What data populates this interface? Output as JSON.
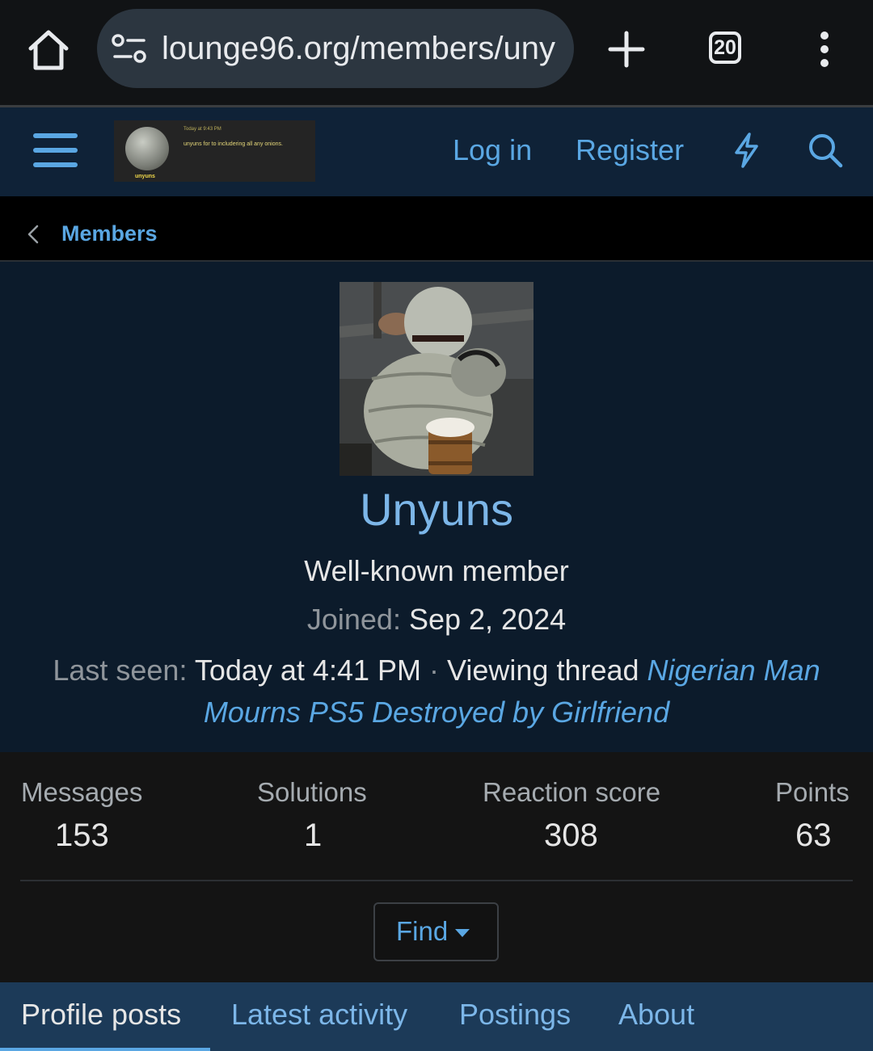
{
  "browser": {
    "url": "lounge96.org/members/uny",
    "tab_count": "20"
  },
  "header": {
    "logo": {
      "time": "Today at 9:43 PM",
      "message": "unyuns for to includering all any onions.",
      "name": "unyuns"
    },
    "login_label": "Log in",
    "register_label": "Register"
  },
  "breadcrumb": {
    "label": "Members"
  },
  "profile": {
    "username": "Unyuns",
    "user_title": "Well-known member",
    "joined_label": "Joined:",
    "joined_value": "Sep 2, 2024",
    "last_seen_label": "Last seen:",
    "last_seen_value": "Today at 4:41 PM",
    "separator": "·",
    "activity": "Viewing thread",
    "thread_title": "Nigerian Man Mourns PS5 Destroyed by Girlfriend"
  },
  "stats": [
    {
      "label": "Messages",
      "value": "153"
    },
    {
      "label": "Solutions",
      "value": "1"
    },
    {
      "label": "Reaction score",
      "value": "308"
    },
    {
      "label": "Points",
      "value": "63"
    }
  ],
  "find_label": "Find",
  "tabs": [
    {
      "label": "Profile posts",
      "active": true
    },
    {
      "label": "Latest activity",
      "active": false
    },
    {
      "label": "Postings",
      "active": false
    },
    {
      "label": "About",
      "active": false
    }
  ],
  "colors": {
    "link": "#5aa7e3",
    "header_bg": "#0f2237",
    "profile_bg": "#0c1b2b",
    "tabs_bg": "#1c3a58"
  }
}
